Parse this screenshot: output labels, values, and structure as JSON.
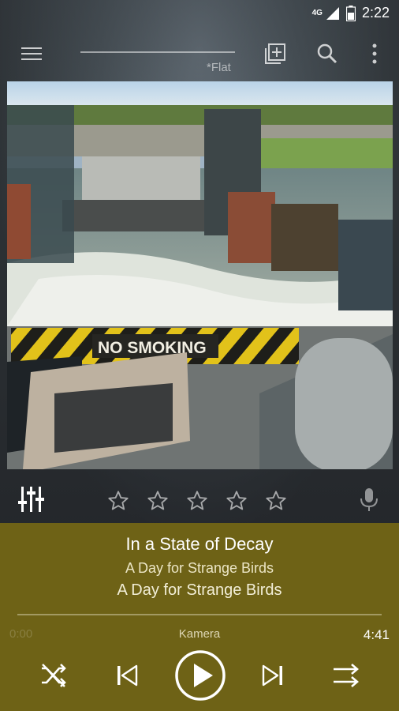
{
  "status": {
    "network": "4G",
    "time": "2:22"
  },
  "toolbar": {
    "preset": "*Flat",
    "icons": [
      "menu-icon",
      "add-to-playlist-icon",
      "search-icon",
      "more-vert-icon"
    ]
  },
  "artwork": {
    "sign_text": "NO SMOKING"
  },
  "rating": {
    "stars_total": 5,
    "stars_filled": 0
  },
  "track": {
    "title": "In a State of Decay",
    "album": "A Day for Strange Birds",
    "artist": "A Day for Strange Birds"
  },
  "playback": {
    "elapsed": "0:00",
    "output": "Kamera",
    "duration": "4:41",
    "progress": 0.0
  },
  "colors": {
    "panel": "#6e6216",
    "accent": "#ffffff"
  }
}
